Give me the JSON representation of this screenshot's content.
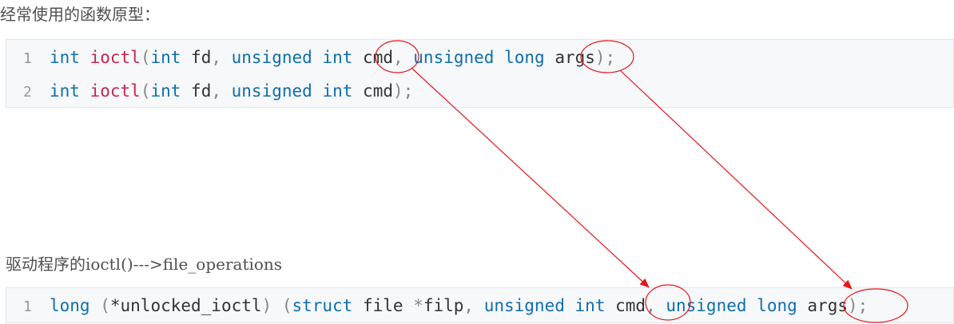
{
  "intro_text": "经常使用的函数原型：",
  "driver_text": "驱动程序的ioctl()--->file_operations",
  "block1": {
    "lines": [
      {
        "num": "1",
        "tokens": [
          {
            "t": "int",
            "c": "kw"
          },
          {
            "t": " ",
            "c": "id"
          },
          {
            "t": "ioctl",
            "c": "fn"
          },
          {
            "t": "(",
            "c": "pu"
          },
          {
            "t": "int",
            "c": "kw"
          },
          {
            "t": " fd",
            "c": "id"
          },
          {
            "t": ", ",
            "c": "pu"
          },
          {
            "t": "unsigned",
            "c": "kw"
          },
          {
            "t": " ",
            "c": "id"
          },
          {
            "t": "int",
            "c": "kw"
          },
          {
            "t": " ",
            "c": "id"
          },
          {
            "t": "cmd",
            "c": "id"
          },
          {
            "t": ", ",
            "c": "pu"
          },
          {
            "t": "unsigned",
            "c": "kw"
          },
          {
            "t": " ",
            "c": "id"
          },
          {
            "t": "long",
            "c": "kw"
          },
          {
            "t": " ",
            "c": "id"
          },
          {
            "t": "args",
            "c": "id"
          },
          {
            "t": ");",
            "c": "pu"
          }
        ]
      },
      {
        "num": "2",
        "tokens": [
          {
            "t": "int",
            "c": "kw"
          },
          {
            "t": " ",
            "c": "id"
          },
          {
            "t": "ioctl",
            "c": "fn"
          },
          {
            "t": "(",
            "c": "pu"
          },
          {
            "t": "int",
            "c": "kw"
          },
          {
            "t": " fd",
            "c": "id"
          },
          {
            "t": ", ",
            "c": "pu"
          },
          {
            "t": "unsigned",
            "c": "kw"
          },
          {
            "t": " ",
            "c": "id"
          },
          {
            "t": "int",
            "c": "kw"
          },
          {
            "t": " ",
            "c": "id"
          },
          {
            "t": "cmd",
            "c": "id"
          },
          {
            "t": ");",
            "c": "pu"
          }
        ]
      }
    ]
  },
  "block2": {
    "lines": [
      {
        "num": "1",
        "tokens": [
          {
            "t": "long",
            "c": "kw"
          },
          {
            "t": " (",
            "c": "pu"
          },
          {
            "t": "*unlocked_ioctl",
            "c": "id"
          },
          {
            "t": ") (",
            "c": "pu"
          },
          {
            "t": "struct",
            "c": "kw"
          },
          {
            "t": " file ",
            "c": "id"
          },
          {
            "t": "*",
            "c": "pu"
          },
          {
            "t": "filp",
            "c": "id"
          },
          {
            "t": ", ",
            "c": "pu"
          },
          {
            "t": "unsigned",
            "c": "kw"
          },
          {
            "t": " ",
            "c": "id"
          },
          {
            "t": "int",
            "c": "kw"
          },
          {
            "t": " ",
            "c": "id"
          },
          {
            "t": "cmd",
            "c": "id"
          },
          {
            "t": ", ",
            "c": "pu"
          },
          {
            "t": "unsigned",
            "c": "kw"
          },
          {
            "t": " ",
            "c": "id"
          },
          {
            "t": "long",
            "c": "kw"
          },
          {
            "t": " ",
            "c": "id"
          },
          {
            "t": "args",
            "c": "id"
          },
          {
            "t": ");",
            "c": "pu"
          }
        ]
      }
    ]
  },
  "colors": {
    "keyword": "#0e6fac",
    "function_name": "#c7254e",
    "identifier": "#333333",
    "punctuation": "#888888",
    "line_number": "#999999",
    "annotation": "#e8141a",
    "code_background": "#f6f8fa"
  }
}
